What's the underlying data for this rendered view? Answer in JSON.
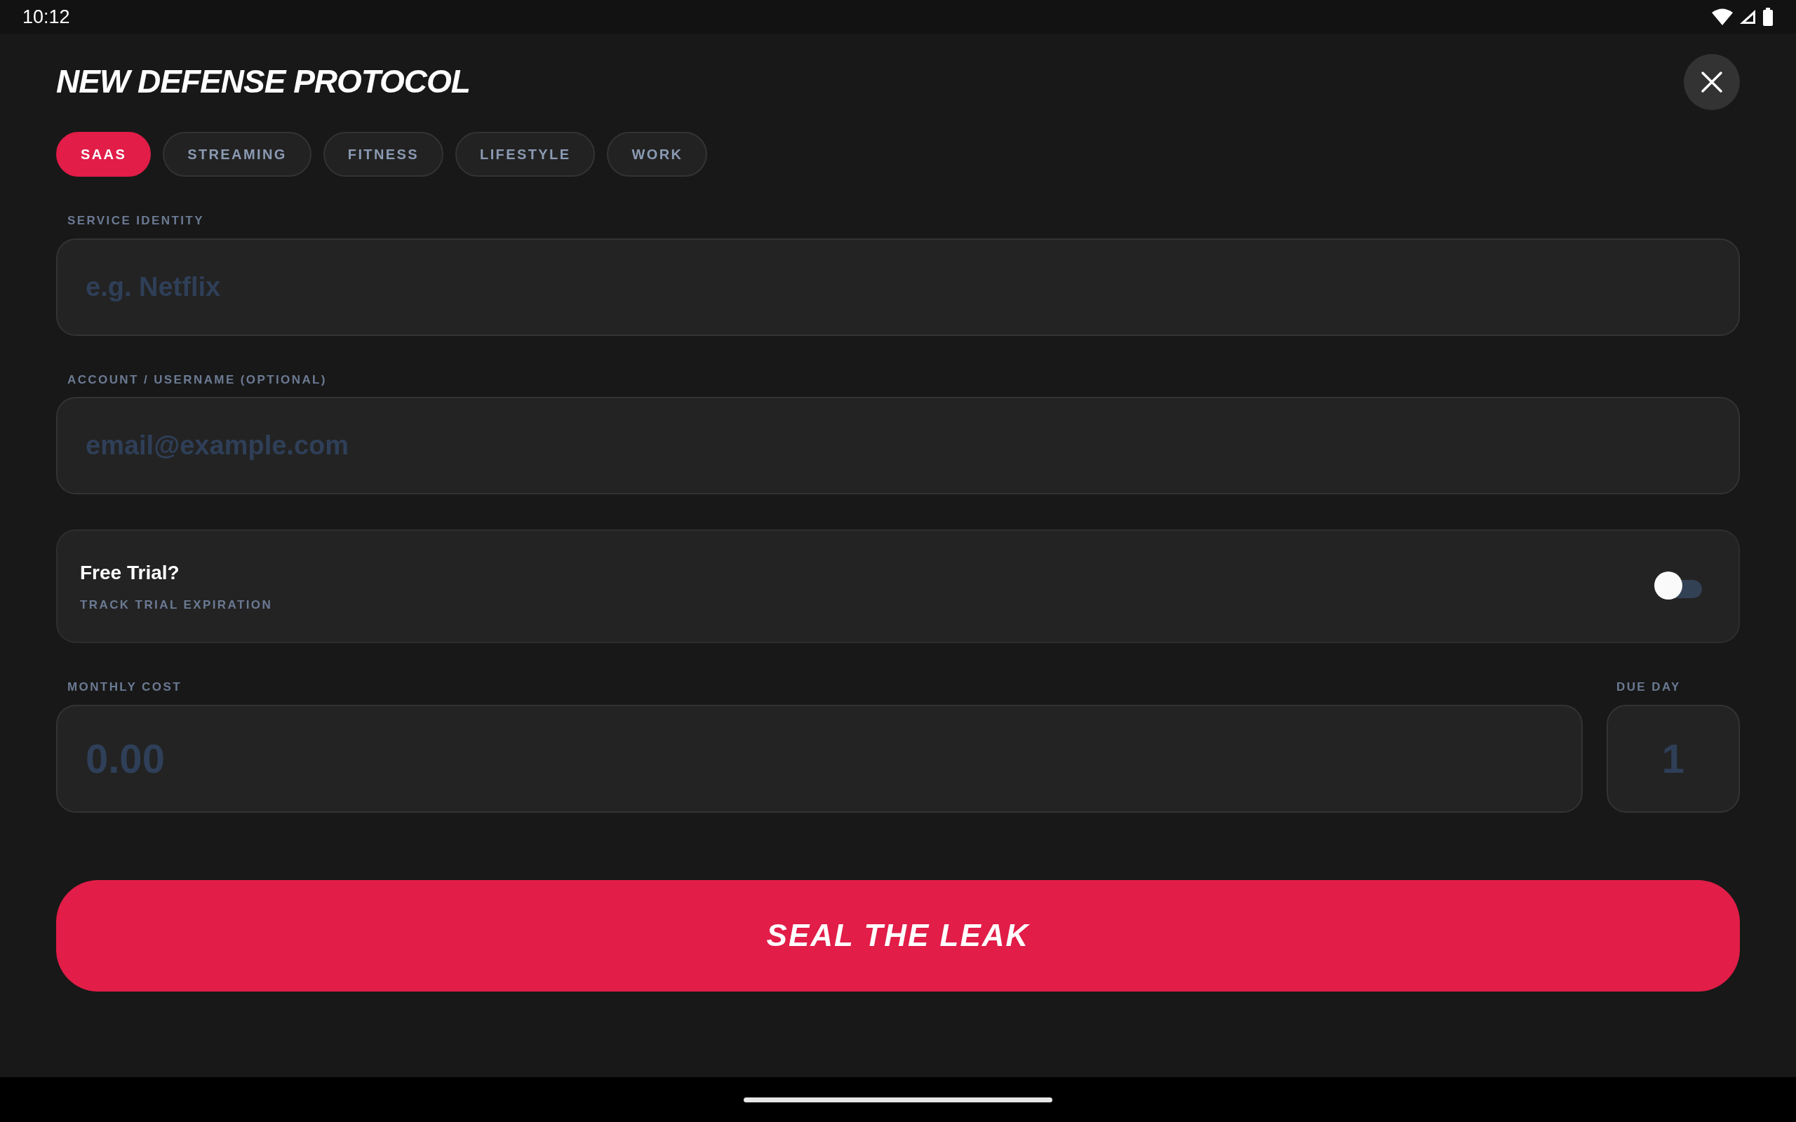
{
  "status_bar": {
    "time": "10:12"
  },
  "dialog": {
    "title": "NEW DEFENSE PROTOCOL"
  },
  "categories": [
    {
      "label": "SAAS",
      "selected": true
    },
    {
      "label": "STREAMING",
      "selected": false
    },
    {
      "label": "FITNESS",
      "selected": false
    },
    {
      "label": "LIFESTYLE",
      "selected": false
    },
    {
      "label": "WORK",
      "selected": false
    }
  ],
  "service_field": {
    "label": "SERVICE IDENTITY",
    "placeholder": "e.g. Netflix"
  },
  "account_field": {
    "label": "ACCOUNT / USERNAME (OPTIONAL)",
    "placeholder": "email@example.com"
  },
  "free_trial": {
    "title": "Free Trial?",
    "subtitle": "TRACK TRIAL EXPIRATION",
    "on": false
  },
  "cost_field": {
    "label": "MONTHLY COST",
    "placeholder": "0.00"
  },
  "due_day_field": {
    "label": "DUE DAY",
    "placeholder": "1"
  },
  "submit_button": {
    "label": "SEAL THE LEAK"
  }
}
